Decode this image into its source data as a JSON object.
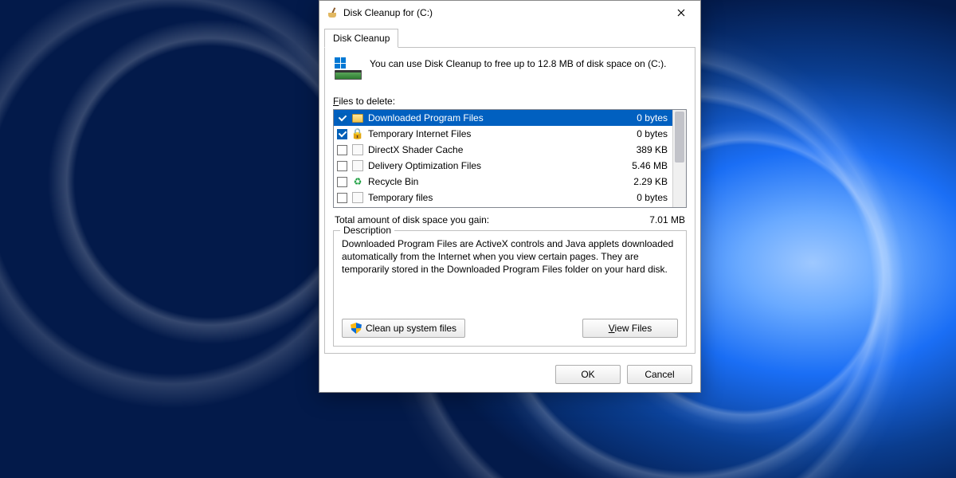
{
  "title": "Disk Cleanup for  (C:)",
  "tab_label": "Disk Cleanup",
  "summary_text": "You can use Disk Cleanup to free up to 12.8 MB of disk space on  (C:).",
  "files_label_pre": "F",
  "files_label_post": "iles to delete:",
  "items": [
    {
      "name": "Downloaded Program Files",
      "size": "0 bytes",
      "checked": true,
      "icon": "folder",
      "selected": true
    },
    {
      "name": "Temporary Internet Files",
      "size": "0 bytes",
      "checked": true,
      "icon": "lock",
      "selected": false
    },
    {
      "name": "DirectX Shader Cache",
      "size": "389 KB",
      "checked": false,
      "icon": "blank",
      "selected": false
    },
    {
      "name": "Delivery Optimization Files",
      "size": "5.46 MB",
      "checked": false,
      "icon": "blank",
      "selected": false
    },
    {
      "name": "Recycle Bin",
      "size": "2.29 KB",
      "checked": false,
      "icon": "recycle",
      "selected": false
    },
    {
      "name": "Temporary files",
      "size": "0 bytes",
      "checked": false,
      "icon": "blank",
      "selected": false
    }
  ],
  "total_label": "Total amount of disk space you gain:",
  "total_value": "7.01 MB",
  "description": {
    "legend": "Description",
    "text": "Downloaded Program Files are ActiveX controls and Java applets downloaded automatically from the Internet when you view certain pages. They are temporarily stored in the Downloaded Program Files folder on your hard disk."
  },
  "buttons": {
    "clean_system": "Clean up system files",
    "view_files_pre": "V",
    "view_files_post": "iew Files",
    "ok": "OK",
    "cancel": "Cancel"
  }
}
